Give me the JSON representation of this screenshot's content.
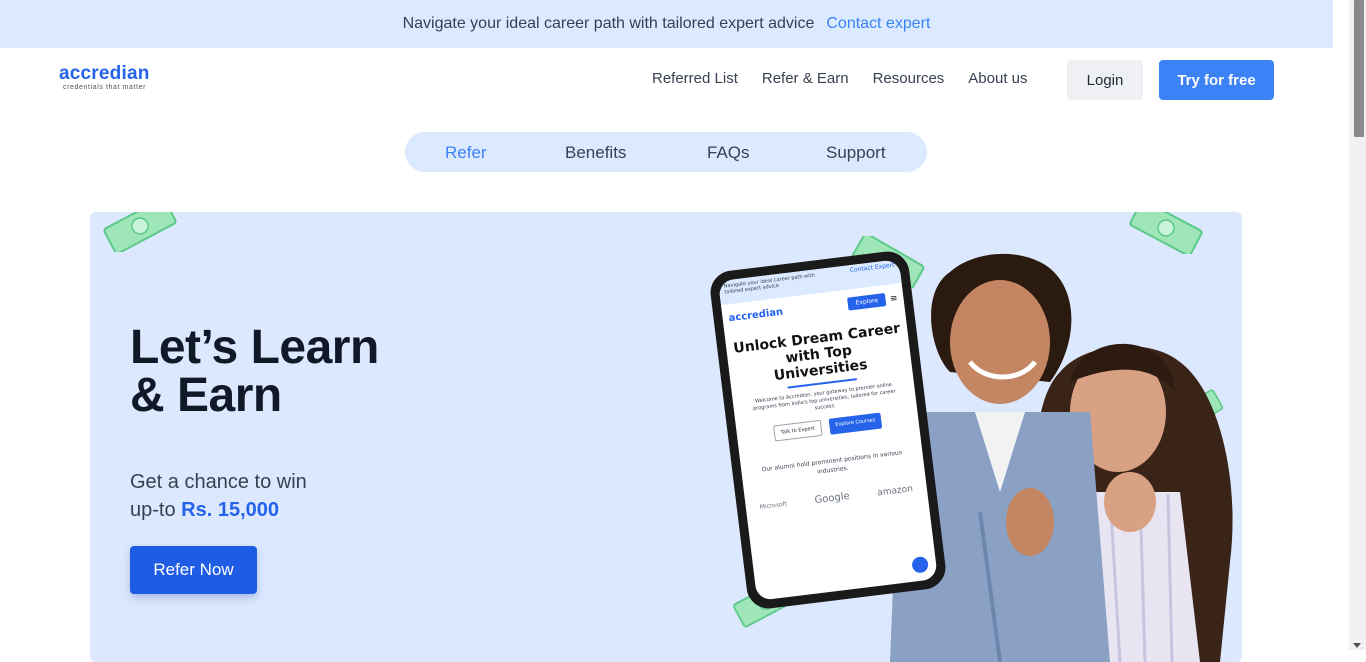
{
  "banner": {
    "message": "Navigate your ideal career path with tailored expert advice",
    "link": "Contact expert"
  },
  "logo": {
    "name": "accredian",
    "tagline": "credentials that matter"
  },
  "nav": {
    "items": [
      "Referred List",
      "Refer & Earn",
      "Resources",
      "About us"
    ],
    "login": "Login",
    "try": "Try for free"
  },
  "tabs": {
    "items": [
      "Refer",
      "Benefits",
      "FAQs",
      "Support"
    ],
    "active": "Refer"
  },
  "hero": {
    "title_line1": "Let’s Learn",
    "title_line2": "& Earn",
    "sub_line1": "Get a chance to win",
    "sub_prefix": "up-to ",
    "amount": "Rs. 15,000",
    "cta": "Refer Now"
  },
  "phone": {
    "banner": "Navigate your ideal career path with tailored expert advice",
    "contact": "Contact Expert",
    "logo": "accredian",
    "explore": "Explore",
    "headline1": "Unlock Dream Career",
    "headline2": "with Top",
    "headline3": "Universities",
    "body": "Welcome to Accredian, your gateway to premier online programs from India's top universities, tailored for career success.",
    "btn1": "Talk to Expert",
    "btn2": "Explore Courses",
    "alumni": "Our alumni hold prominent positions in various industries.",
    "brands": [
      "Microsoft",
      "Google",
      "amazon"
    ]
  },
  "colors": {
    "accent": "#3b82f6",
    "banner_bg": "#dbeafe",
    "hero_bg": "#dbe8fd",
    "cta": "#1e5ce6"
  }
}
